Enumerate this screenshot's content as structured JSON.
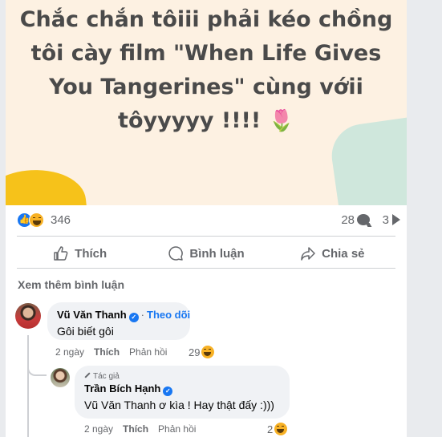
{
  "post": {
    "text_lines": [
      "Chắc chắn tôiii phải kéo chồng",
      "tôi cày film \"When Life Gives",
      "You Tangerines\" cùng vớii",
      "tôyyyyy !!!!"
    ],
    "emoji": "🌷"
  },
  "reactions": {
    "count": "346",
    "comments": "28",
    "shares": "3"
  },
  "actions": {
    "like": "Thích",
    "comment": "Bình luận",
    "share": "Chia sẻ"
  },
  "comments_section": {
    "more_label": "Xem thêm bình luận",
    "comment1": {
      "author": "Vũ Văn Thanh",
      "follow": "Theo dõi",
      "separator": "·",
      "text": "Gôi biết gôi",
      "time": "2 ngày",
      "like": "Thích",
      "reply": "Phản hồi",
      "reaction_count": "29"
    },
    "reply1": {
      "author_tag": "Tác giả",
      "author": "Trần Bích Hạnh",
      "text": "Vũ Văn Thanh ơ kìa ! Hay thật đấy :)))",
      "time": "2 ngày",
      "like": "Thích",
      "reply": "Phản hồi",
      "reaction_count": "2"
    }
  },
  "colors": {
    "accent": "#1877f2",
    "muted": "#65676b",
    "bubble": "#f0f2f5",
    "post_bg": "#fdf1e2"
  }
}
